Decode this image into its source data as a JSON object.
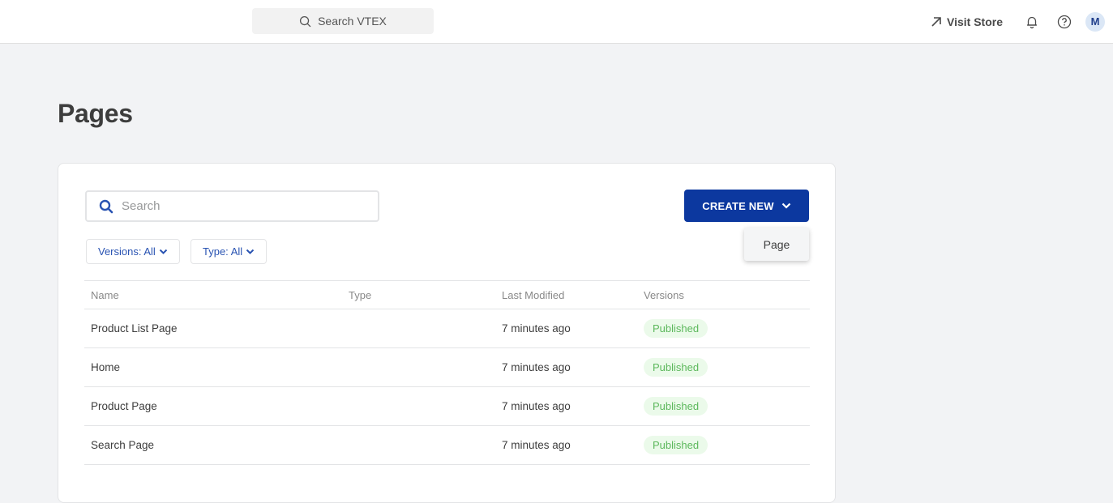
{
  "topbar": {
    "search_label": "Search VTEX",
    "visit_store_label": "Visit Store",
    "avatar_initial": "M"
  },
  "page": {
    "title": "Pages"
  },
  "toolbar": {
    "search_placeholder": "Search",
    "search_value": "",
    "filters": [
      {
        "label": "Versions: All"
      },
      {
        "label": "Type: All"
      }
    ],
    "create_label": "CREATE NEW",
    "dropdown_items": [
      {
        "label": "Page"
      }
    ]
  },
  "table": {
    "columns": [
      "Name",
      "Type",
      "Last Modified",
      "Versions"
    ],
    "rows": [
      {
        "name": "Product List Page",
        "type": "",
        "modified": "7 minutes ago",
        "version": "Published"
      },
      {
        "name": "Home",
        "type": "",
        "modified": "7 minutes ago",
        "version": "Published"
      },
      {
        "name": "Product Page",
        "type": "",
        "modified": "7 minutes ago",
        "version": "Published"
      },
      {
        "name": "Search Page",
        "type": "",
        "modified": "7 minutes ago",
        "version": "Published"
      }
    ]
  },
  "colors": {
    "primary": "#0c389f",
    "link": "#2953b2",
    "published_bg": "#ebfaea",
    "published_text": "#5cb85c"
  }
}
